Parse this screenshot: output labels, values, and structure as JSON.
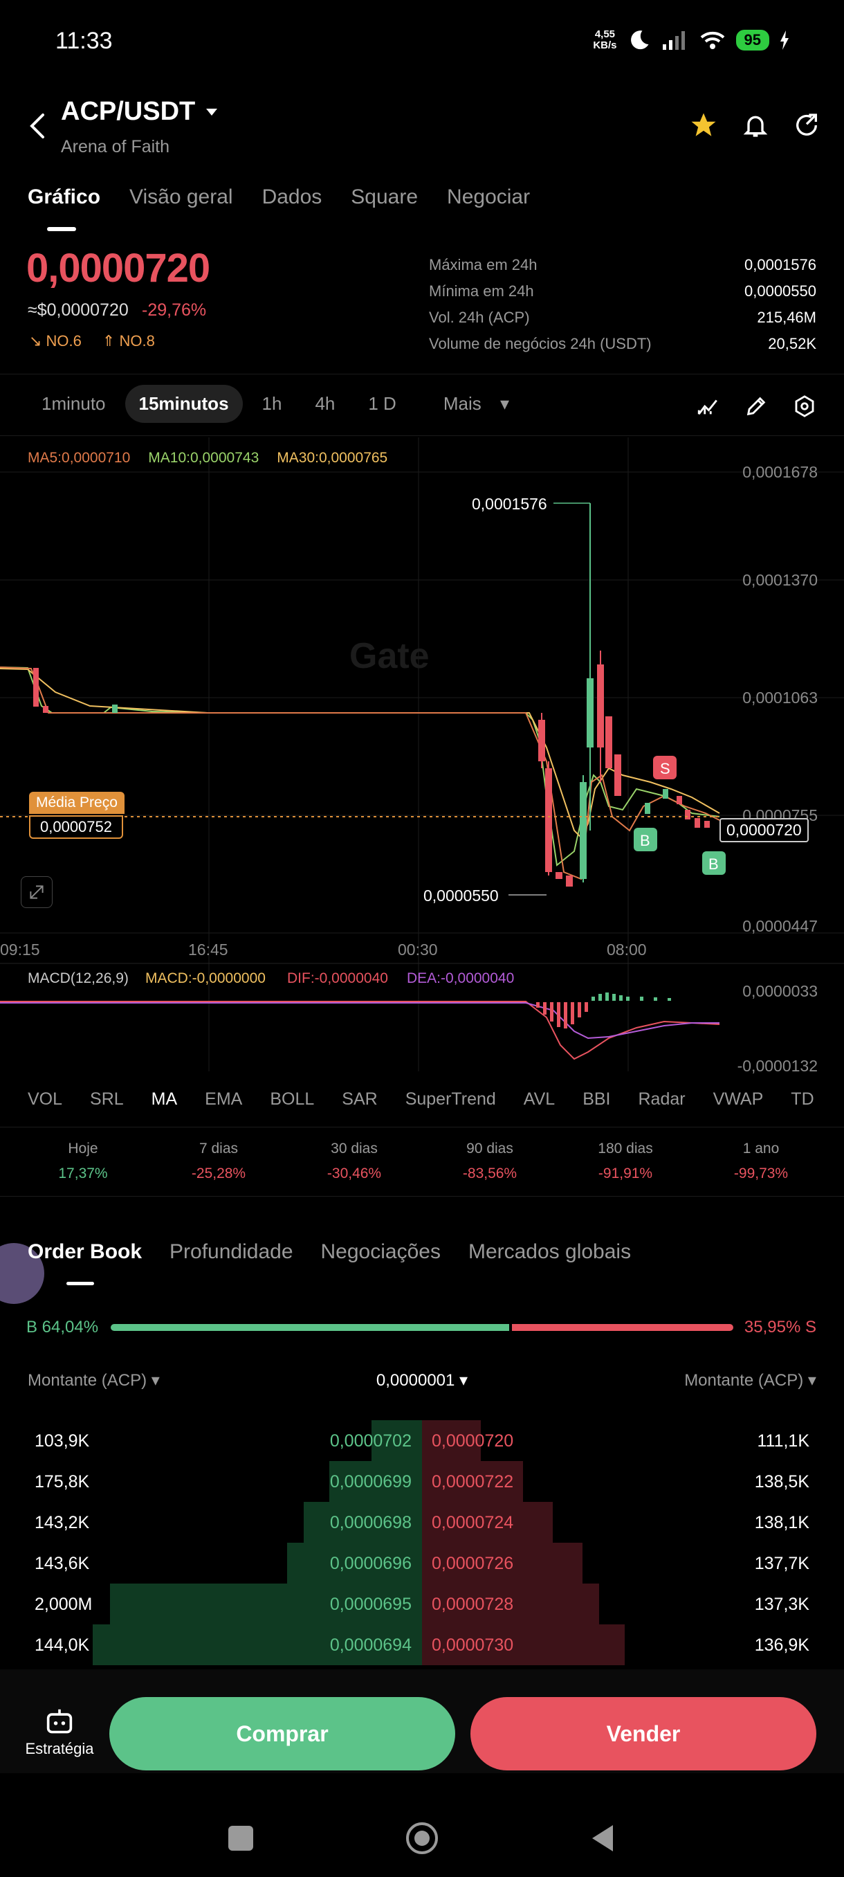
{
  "status": {
    "time": "11:33",
    "net_speed_top": "4,55",
    "net_speed_bottom": "KB/s",
    "battery": "95"
  },
  "header": {
    "pair": "ACP/USDT",
    "subtitle": "Arena of Faith"
  },
  "tabs": [
    "Gráfico",
    "Visão geral",
    "Dados",
    "Square",
    "Negociar"
  ],
  "price": {
    "last": "0,0000720",
    "usd": "≈$0,0000720",
    "change": "-29,76%",
    "rank_down": "NO.6",
    "rank_up": "NO.8"
  },
  "stats": [
    {
      "label": "Máxima em 24h",
      "value": "0,0001576"
    },
    {
      "label": "Mínima em 24h",
      "value": "0,0000550"
    },
    {
      "label": "Vol. 24h (ACP)",
      "value": "215,46M"
    },
    {
      "label": "Volume de negócios 24h (USDT)",
      "value": "20,52K"
    }
  ],
  "timeframes": [
    "1minuto",
    "15minutos",
    "1h",
    "4h",
    "1 D",
    "Mais"
  ],
  "ma_legend": {
    "ma5": "MA5:0,0000710",
    "ma10": "MA10:0,0000743",
    "ma30": "MA30:0,0000765"
  },
  "chart_labels": {
    "high": "0,0001576",
    "low": "0,0000550",
    "avg_label": "Média Preço",
    "avg_value": "0,0000752",
    "last_box": "0,0000720",
    "watermark": "Gate",
    "y_ticks": [
      "0,0001678",
      "0,0001370",
      "0,0001063",
      "0,0000755",
      "0,0000447"
    ],
    "x_ticks": [
      "09:15",
      "16:45",
      "00:30",
      "08:00"
    ],
    "marker_s": "S",
    "marker_b": "B"
  },
  "macd": {
    "title": "MACD(12,26,9)",
    "macd": "MACD:-0,0000000",
    "dif": "DIF:-0,0000040",
    "dea": "DEA:-0,0000040",
    "y_top": "0,0000033",
    "y_bottom": "-0,0000132"
  },
  "indicators": [
    "VOL",
    "SRL",
    "MA",
    "EMA",
    "BOLL",
    "SAR",
    "SuperTrend",
    "AVL",
    "BBI",
    "Radar",
    "VWAP",
    "TD"
  ],
  "performance": [
    {
      "label": "Hoje",
      "value": "17,37%"
    },
    {
      "label": "7 dias",
      "value": "-25,28%"
    },
    {
      "label": "30 dias",
      "value": "-30,46%"
    },
    {
      "label": "90 dias",
      "value": "-83,56%"
    },
    {
      "label": "180 dias",
      "value": "-91,91%"
    },
    {
      "label": "1 ano",
      "value": "-99,73%"
    }
  ],
  "orderbook_tabs": [
    "Order Book",
    "Profundidade",
    "Negociações",
    "Mercados globais"
  ],
  "ratio": {
    "buy": "B 64,04%",
    "sell": "35,95% S",
    "buy_fraction": 0.6404
  },
  "ob_header": {
    "left": "Montante (ACP)",
    "mid": "0,0000001",
    "right": "Montante (ACP)"
  },
  "orders": [
    {
      "bid_amt": "103,9K",
      "bid_px": "0,0000702",
      "ask_px": "0,0000720",
      "ask_amt": "111,1K",
      "bid_depth": 0.12,
      "ask_depth": 0.14
    },
    {
      "bid_amt": "175,8K",
      "bid_px": "0,0000699",
      "ask_px": "0,0000722",
      "ask_amt": "138,5K",
      "bid_depth": 0.22,
      "ask_depth": 0.24
    },
    {
      "bid_amt": "143,2K",
      "bid_px": "0,0000698",
      "ask_px": "0,0000724",
      "ask_amt": "138,1K",
      "bid_depth": 0.28,
      "ask_depth": 0.31
    },
    {
      "bid_amt": "143,6K",
      "bid_px": "0,0000696",
      "ask_px": "0,0000726",
      "ask_amt": "137,7K",
      "bid_depth": 0.32,
      "ask_depth": 0.38
    },
    {
      "bid_amt": "2,000M",
      "bid_px": "0,0000695",
      "ask_px": "0,0000728",
      "ask_amt": "137,3K",
      "bid_depth": 0.74,
      "ask_depth": 0.42
    },
    {
      "bid_amt": "144,0K",
      "bid_px": "0,0000694",
      "ask_px": "0,0000730",
      "ask_amt": "136,9K",
      "bid_depth": 0.78,
      "ask_depth": 0.48
    }
  ],
  "bottom": {
    "strategy": "Estratégia",
    "buy": "Comprar",
    "sell": "Vender"
  },
  "colors": {
    "up": "#5cc389",
    "down": "#e8535f",
    "ma5": "#e07a4a",
    "ma10": "#9ad36a",
    "ma30": "#f0c060",
    "dif": "#e8535f",
    "dea": "#b45cd8"
  },
  "icons": [
    "back-arrow-icon",
    "caret-down-icon",
    "star-icon",
    "bell-icon",
    "share-icon",
    "indicator-icon",
    "pencil-icon",
    "settings-icon",
    "expand-icon",
    "robot-icon",
    "home-icon",
    "recent-icon",
    "back-nav-icon"
  ]
}
